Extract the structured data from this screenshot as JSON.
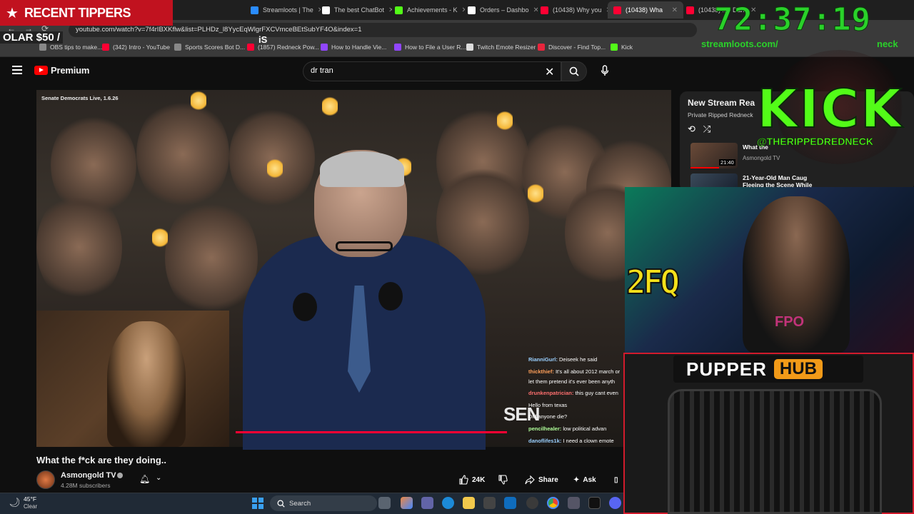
{
  "browser": {
    "tabs": [
      {
        "label": "Recent Tippers  Redneck",
        "icon_color": "#c1121f",
        "active": false
      },
      {
        "label": "Streamloots | The",
        "icon_color": "#2a8cff",
        "active": false
      },
      {
        "label": "The best ChatBot",
        "icon_color": "#ffffff",
        "active": false
      },
      {
        "label": "Achievements - K",
        "icon_color": "#53fc18",
        "active": false
      },
      {
        "label": "Orders – Dashbo",
        "icon_color": "#ffffff",
        "active": false
      },
      {
        "label": "(10438) Why you",
        "icon_color": "#ff0033",
        "active": false
      },
      {
        "label": "(10438) Wha",
        "icon_color": "#ff0033",
        "active": true
      },
      {
        "label": "(10438) My Dark",
        "icon_color": "#ff0033",
        "active": false
      }
    ],
    "url": "youtube.com/watch?v=7f4rIBXKflw&list=PLHDz_l8YycEqWlgrFXCVmceBEtSubYF4O&index=1",
    "bookmarks": [
      {
        "label": "OBS tips to make...",
        "icon_color": "#888888"
      },
      {
        "label": "(342) Intro - YouTube",
        "icon_color": "#ff0033"
      },
      {
        "label": "Sports Scores Bot D...",
        "icon_color": "#888888"
      },
      {
        "label": "(1857) Redneck Pow...",
        "icon_color": "#ff0033"
      },
      {
        "label": "How to Handle Vie...",
        "icon_color": "#9146ff"
      },
      {
        "label": "How to File a User R...",
        "icon_color": "#9146ff"
      },
      {
        "label": "Twitch Emote Resizer",
        "icon_color": "#dddddd"
      },
      {
        "label": "Discover - Find Top...",
        "icon_color": "#e8253c"
      },
      {
        "label": "Kick",
        "icon_color": "#53fc18"
      }
    ]
  },
  "youtube": {
    "logo_text": "Premium",
    "search": {
      "value": "dr tran"
    },
    "video": {
      "caption": "Senate Democrats Live, 1.6.26",
      "overlay_text": "SEN",
      "title": "What the f*ck are they doing..",
      "progress": 1.0
    },
    "channel": {
      "name": "Asmongold TV",
      "subscribers": "4.28M subscribers"
    },
    "actions": {
      "likes": "24K",
      "share": "Share",
      "ask": "Ask"
    },
    "chat": [
      {
        "user": "RianniGurl:",
        "msg": "Deiseek he said",
        "color": "#9ad0ff"
      },
      {
        "user": "thickthief:",
        "msg": "It's all about 2012 march or",
        "color": "#ff9f5a"
      },
      {
        "user": "",
        "msg": "let them pretend it's ever been anyth",
        "color": "#ffffff"
      },
      {
        "user": "drunkenpatrician:",
        "msg": "this guy cant even",
        "color": "#ff6f6f"
      },
      {
        "user": "",
        "msg": "Hello from texas",
        "color": "#8aa0ff"
      },
      {
        "user": "",
        "msg": "Did anyone die?",
        "color": "#ff5a8a"
      },
      {
        "user": "pencilhealer:",
        "msg": "low political advan",
        "color": "#b0ff9a"
      },
      {
        "user": "danoflifes1k:",
        "msg": "I need a clown emote",
        "color": "#9ad0ff"
      }
    ],
    "playlist": {
      "title": "New Stream Rea",
      "subtitle": "Private Ripped Redneck",
      "items": [
        {
          "title": "What the",
          "channel": "Asmongold TV",
          "duration": "21:40"
        },
        {
          "title": "21-Year-Old Man Caug Fleeing the Scene While",
          "channel": ""
        }
      ]
    }
  },
  "overlays": {
    "recent_tippers": "RECENT TIPPERS",
    "tipper_line": "OLAR $50 /",
    "tipper_extra": "iS",
    "timer": "72:37:19",
    "streamloots_url": "streamloots.com/",
    "streamloots_url_tail": "neck",
    "kick_word": "KICK",
    "kick_handle": "@THERIPPEDREDNECK",
    "cam_sign": "2FQ",
    "shirt_text": "FPO",
    "pupper_word": "PUPPER",
    "pupper_hub": "HUB"
  },
  "taskbar": {
    "temp": "45°F",
    "condition": "Clear",
    "search": "Search"
  }
}
